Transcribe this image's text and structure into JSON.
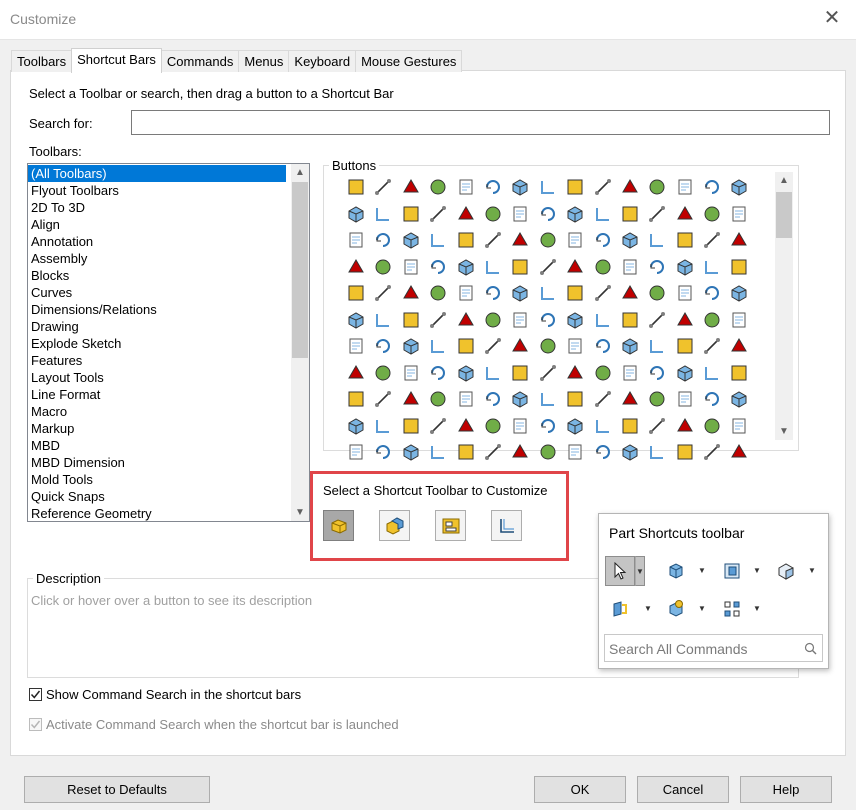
{
  "window": {
    "title": "Customize",
    "close_glyph": "✕"
  },
  "tabs": [
    {
      "label": "Toolbars"
    },
    {
      "label": "Shortcut Bars",
      "active": true
    },
    {
      "label": "Commands"
    },
    {
      "label": "Menus"
    },
    {
      "label": "Keyboard"
    },
    {
      "label": "Mouse Gestures"
    }
  ],
  "instructions": "Select a Toolbar or search, then drag a button to a Shortcut Bar",
  "search": {
    "label": "Search for:",
    "value": ""
  },
  "toolbars": {
    "label": "Toolbars:",
    "selected": "(All Toolbars)",
    "items": [
      "(All Toolbars)",
      "Flyout Toolbars",
      "2D To 3D",
      "Align",
      "Annotation",
      "Assembly",
      "Blocks",
      "Curves",
      "Dimensions/Relations",
      "Drawing",
      "Explode Sketch",
      "Features",
      "Layout Tools",
      "Line Format",
      "Macro",
      "Markup",
      "MBD",
      "MBD Dimension",
      "Mold Tools",
      "Quick Snaps",
      "Reference Geometry"
    ]
  },
  "buttons_panel": {
    "label": "Buttons",
    "rows": 11,
    "columns": 15
  },
  "shortcut_selector": {
    "label": "Select a Shortcut Toolbar to Customize",
    "options": [
      {
        "icon": "part-icon",
        "selected": true
      },
      {
        "icon": "assembly-icon",
        "selected": false
      },
      {
        "icon": "drawing-icon",
        "selected": false
      },
      {
        "icon": "sketch-icon",
        "selected": false
      }
    ]
  },
  "description": {
    "label": "Description",
    "placeholder": "Click or hover over a button to see its description"
  },
  "options": {
    "show_search_label": "Show Command Search in the shortcut bars",
    "show_search_checked": true,
    "activate_search_label": "Activate Command Search when the shortcut bar is launched",
    "activate_search_checked": true,
    "activate_search_disabled": true
  },
  "popup": {
    "title": "Part Shortcuts toolbar",
    "buttons": [
      "select-arrow-icon",
      "extruded-boss-icon",
      "view-orientation-icon",
      "display-style-icon",
      "reference-plane-icon",
      "appearance-icon",
      "hide-show-icon"
    ],
    "search_placeholder": "Search All Commands"
  },
  "footer": {
    "reset_label": "Reset to Defaults",
    "ok_label": "OK",
    "cancel_label": "Cancel",
    "help_label": "Help"
  },
  "colors": {
    "accent": "#0078d7",
    "highlight_border": "#e04549",
    "icon_gold": "#f0c22c",
    "icon_blue": "#5a9bd5"
  }
}
